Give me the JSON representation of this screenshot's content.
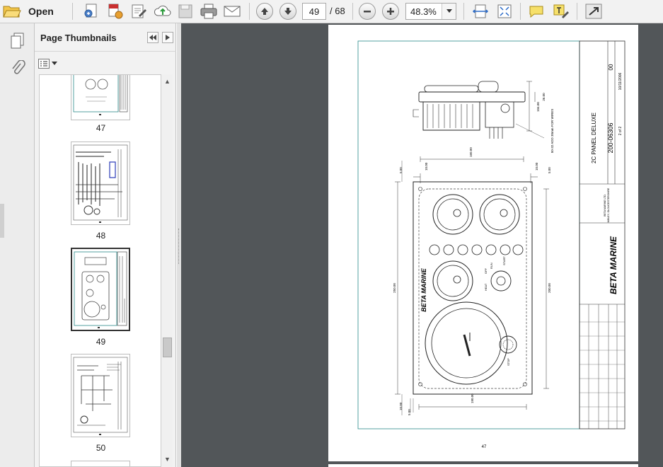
{
  "toolbar": {
    "open_label": "Open",
    "current_page": "49",
    "page_total": "/ 68",
    "zoom": "48.3%",
    "icons": [
      "folder-open-icon",
      "create-pdf-icon",
      "convert-pdf-icon",
      "edit-form-icon",
      "upload-cloud-icon",
      "save-icon",
      "print-icon",
      "email-icon",
      "page-up-icon",
      "page-down-icon",
      "zoom-out-icon",
      "zoom-in-icon",
      "fit-width-icon",
      "full-screen-icon",
      "comment-icon",
      "sign-icon",
      "expand-icon"
    ]
  },
  "panel": {
    "title": "Page Thumbnails",
    "thumbnails": [
      {
        "label": "47",
        "selected": false
      },
      {
        "label": "48",
        "selected": false
      },
      {
        "label": "49",
        "selected": true
      },
      {
        "label": "50",
        "selected": false
      }
    ]
  },
  "drawing": {
    "title_block": "2C PANEL DELUXE",
    "part_number": "200-06306",
    "issue": "00",
    "date": "10/11/2006",
    "sheet": "2 of 2",
    "dim_bottom": "190.00",
    "dim_top": "160.00",
    "dim_height_left": "250.00",
    "dim_height_right": "200.00",
    "dim_small_a": "5.00",
    "dim_small_b": "10.00",
    "note": "50-32 ADD 30mm FOR WIRES",
    "dim_depth": "26.00",
    "dim_side": "104.00",
    "brand": "BETA MARINE",
    "company_line1": "BETA MARINE LTD.",
    "company_line2": "NIBLEY, GLOUCESTERSHIRE",
    "page_label": "47",
    "label_start": "START",
    "label_stop": "STOP",
    "label_heat": "HEAT",
    "label_run": "RUN",
    "label_off": "OFF"
  }
}
